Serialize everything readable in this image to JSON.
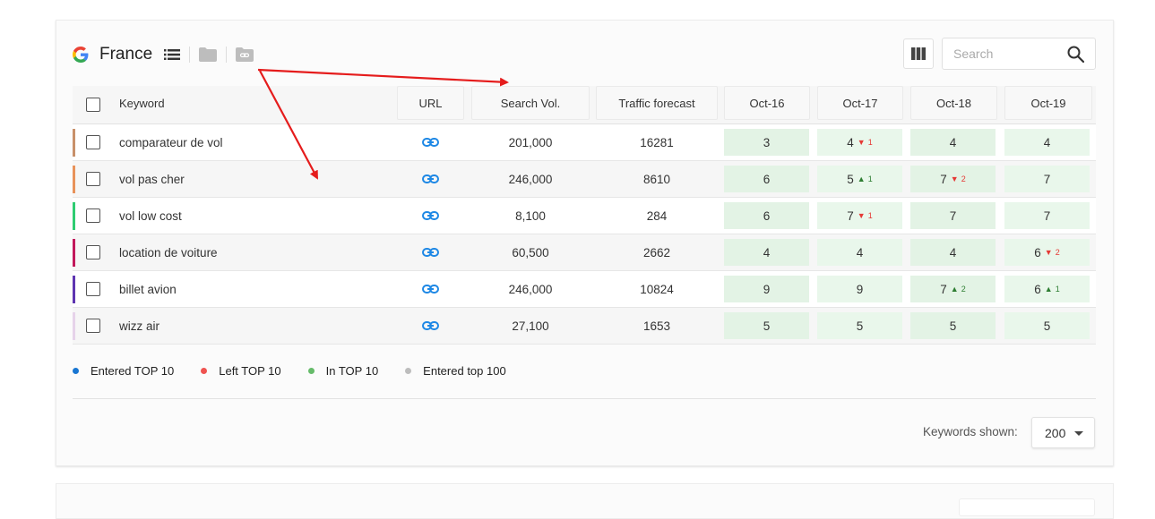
{
  "header": {
    "engine_icon": "google-g-icon",
    "title": "France",
    "icons": [
      "list-icon",
      "folder-icon",
      "link-folder-icon"
    ],
    "columns_icon": "columns-icon",
    "search_placeholder": "Search",
    "search_icon": "search-icon"
  },
  "table": {
    "columns": {
      "keyword": "Keyword",
      "url": "URL",
      "search_vol": "Search Vol.",
      "traffic": "Traffic forecast",
      "dates": [
        "Oct-16",
        "Oct-17",
        "Oct-18",
        "Oct-19"
      ]
    },
    "rows": [
      {
        "keyword": "comparateur de vol",
        "color": "#c8906a",
        "volume": "201,000",
        "traffic": "16281",
        "positions": [
          {
            "v": "3"
          },
          {
            "v": "4",
            "dir": "down",
            "d": "1"
          },
          {
            "v": "4"
          },
          {
            "v": "4"
          }
        ]
      },
      {
        "keyword": "vol pas cher",
        "color": "#e8925a",
        "volume": "246,000",
        "traffic": "8610",
        "positions": [
          {
            "v": "6"
          },
          {
            "v": "5",
            "dir": "up",
            "d": "1"
          },
          {
            "v": "7",
            "dir": "down",
            "d": "2"
          },
          {
            "v": "7"
          }
        ]
      },
      {
        "keyword": "vol low cost",
        "color": "#2ecc71",
        "volume": "8,100",
        "traffic": "284",
        "positions": [
          {
            "v": "6"
          },
          {
            "v": "7",
            "dir": "down",
            "d": "1"
          },
          {
            "v": "7"
          },
          {
            "v": "7"
          }
        ]
      },
      {
        "keyword": "location de voiture",
        "color": "#c2185b",
        "volume": "60,500",
        "traffic": "2662",
        "positions": [
          {
            "v": "4"
          },
          {
            "v": "4"
          },
          {
            "v": "4"
          },
          {
            "v": "6",
            "dir": "down",
            "d": "2"
          }
        ]
      },
      {
        "keyword": "billet avion",
        "color": "#5e35b1",
        "volume": "246,000",
        "traffic": "10824",
        "positions": [
          {
            "v": "9"
          },
          {
            "v": "9"
          },
          {
            "v": "7",
            "dir": "up",
            "d": "2"
          },
          {
            "v": "6",
            "dir": "up",
            "d": "1"
          }
        ]
      },
      {
        "keyword": "wizz air",
        "color": "#e6d3ea",
        "volume": "27,100",
        "traffic": "1653",
        "positions": [
          {
            "v": "5"
          },
          {
            "v": "5"
          },
          {
            "v": "5"
          },
          {
            "v": "5"
          }
        ]
      }
    ]
  },
  "legend": [
    {
      "label": "Entered TOP 10",
      "color": "#1976d2"
    },
    {
      "label": "Left TOP 10",
      "color": "#ef5350"
    },
    {
      "label": "In TOP 10",
      "color": "#66bb6a"
    },
    {
      "label": "Entered top 100",
      "color": "#bdbdbd"
    }
  ],
  "footer": {
    "keywords_shown_label": "Keywords shown:",
    "keywords_shown_value": "200"
  },
  "colors": {
    "annotation_arrow": "#e51c1c",
    "link_icon": "#1e88e5"
  }
}
